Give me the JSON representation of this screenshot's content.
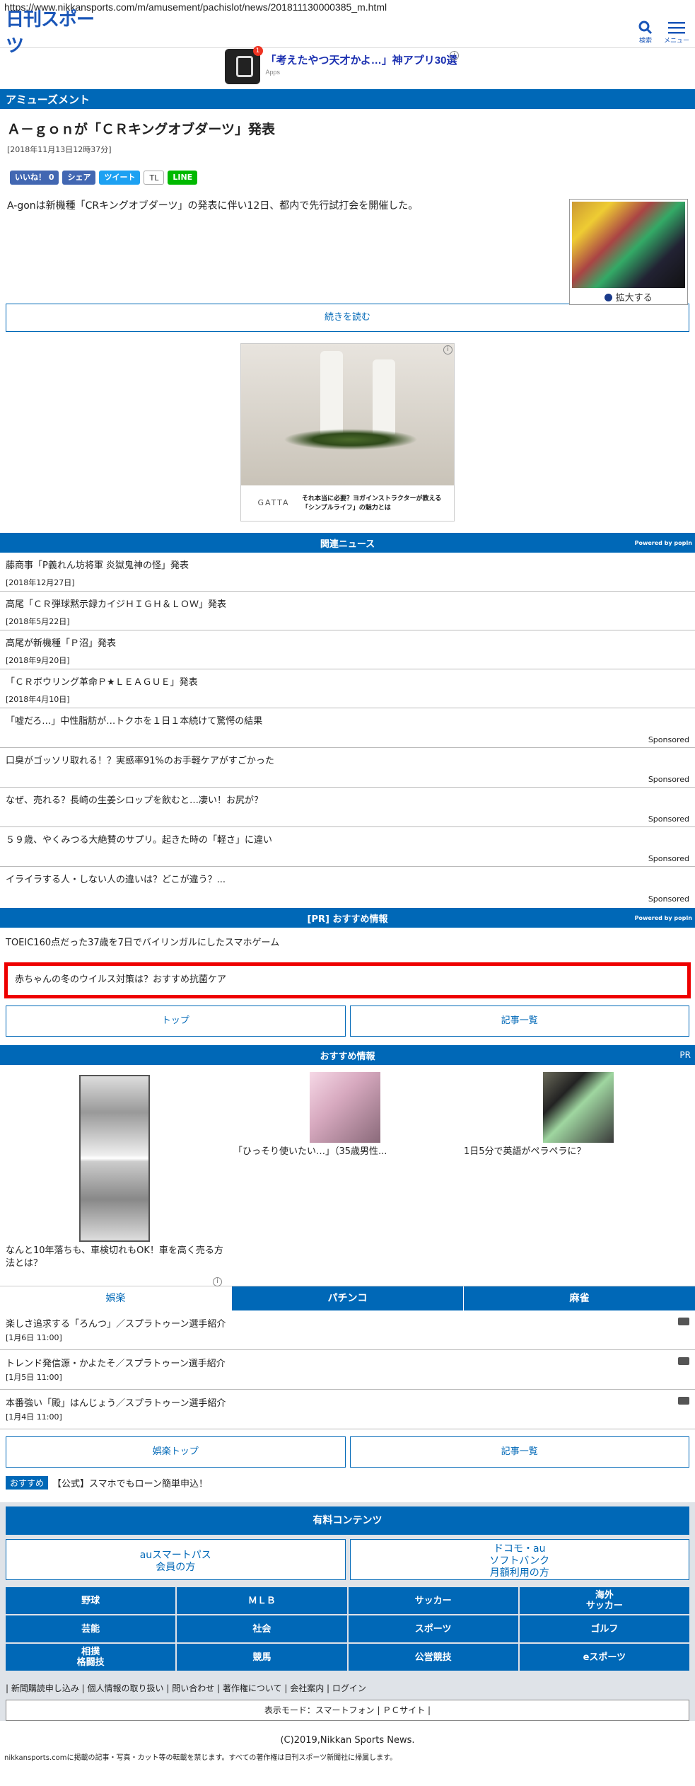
{
  "url": "https://www.nikkansports.com/m/amusement/pachislot/news/201811130000385_m.html",
  "header": {
    "logo": "日刊スポーツ",
    "search_label": "検索",
    "menu_label": "メニュー"
  },
  "ad_top": {
    "text": "「考えたやつ天才かよ…」神アプリ30選",
    "source": "Apps",
    "badge": "1"
  },
  "section": "アミューズメント",
  "article": {
    "title": "Ａ－ｇｏｎが「ＣＲキングオブダーツ」発表",
    "date": "[2018年11月13日12時37分]",
    "social": {
      "like": "いいね！ 0",
      "share": "シェア",
      "tweet": "ツイート",
      "tl": "TL",
      "line": "LINE"
    },
    "lead": "A-gonは新機種「CRキングオブダーツ」の発表に伴い12日、都内で先行試打会を開催した。",
    "photo_caption": "拡大する",
    "read_more": "続きを読む"
  },
  "ad_mid": {
    "brand": "GATTA",
    "text": "それ本当に必要？ヨガインストラクターが教える「シンプルライフ」の魅力とは"
  },
  "related": {
    "header": "関連ニュース",
    "powered": "Powered by popIn",
    "items": [
      {
        "title": "藤商事「P義れん坊将軍 炎獄鬼神の怪」発表",
        "date": "[2018年12月27日]"
      },
      {
        "title": "高尾「ＣＲ弾球黙示録カイジＨＩＧＨ＆ＬＯＷ」発表",
        "date": "[2018年5月22日]"
      },
      {
        "title": "高尾が新機種「Ｐ沼」発表",
        "date": "[2018年9月20日]"
      },
      {
        "title": "「ＣＲボウリング革命Ｐ★ＬＥＡＧＵＥ」発表",
        "date": "[2018年4月10日]"
      }
    ],
    "sponsored_label": "Sponsored",
    "sponsored": [
      "「嘘だろ…」中性脂肪が…トクホを１日１本続けて驚愕の結果",
      "口臭がゴッソリ取れる！？実感率91%のお手軽ケアがすごかった",
      "なぜ、売れる？長崎の生姜シロップを飲むと…凄い！お尻が？",
      "５９歳、やくみつる大絶賛のサプリ。起きた時の「軽さ」に違い",
      "イライラする人・しない人の違いは？どこが違う？..."
    ]
  },
  "pr": {
    "header": "[PR] おすすめ情報",
    "powered": "Powered by popIn",
    "item1": "TOEIC160点だった37歳を7日でバイリンガルにしたスマホゲーム",
    "item2": "赤ちゃんの冬のウイルス対策は？おすすめ抗菌ケア"
  },
  "nav1": {
    "top": "トップ",
    "list": "記事一覧"
  },
  "recommend": {
    "header": "おすすめ情報",
    "pr": "PR",
    "items": [
      "なんと10年落ちも、車検切れもOK！車を高く売る方法とは？",
      "「ひっそり使いたい…」（35歳男性...",
      "1日5分で英語がペラペラに？"
    ]
  },
  "tabs": [
    "娯楽",
    "パチンコ",
    "麻雀"
  ],
  "entertainment": [
    {
      "title": "楽しさ追求する「ろんつ」／スプラトゥーン選手紹介",
      "date": "[1月6日 11:00]"
    },
    {
      "title": "トレンド発信源・かよたそ／スプラトゥーン選手紹介",
      "date": "[1月5日 11:00]"
    },
    {
      "title": "本番強い「殿」はんじょう／スプラトゥーン選手紹介",
      "date": "[1月4日 11:00]"
    }
  ],
  "nav2": {
    "top": "娯楽トップ",
    "list": "記事一覧"
  },
  "osusume": {
    "tag": "おすすめ",
    "text": "【公式】スマホでもローン簡単申込！"
  },
  "footer": {
    "paid": "有料コンテンツ",
    "au": "auスマートパス\n会員の方",
    "docomo": "ドコモ・au\nソフトバンク\n月額利用の方",
    "grid": [
      "野球",
      "ＭＬＢ",
      "サッカー",
      "海外\nサッカー",
      "芸能",
      "社会",
      "スポーツ",
      "ゴルフ",
      "相撲\n格闘技",
      "競馬",
      "公営競技",
      "eスポーツ"
    ],
    "links": "| 新聞購読申し込み | 個人情報の取り扱い | 問い合わせ | 著作権について | 会社案内 | ログイン",
    "mode": "表示モード：スマートフォン | ＰＣサイト |",
    "copyright": "(C)2019,Nikkan Sports News.",
    "notice": "nikkansports.comに掲載の記事・写真・カット等の転載を禁じます。すべての著作権は日刊スポーツ新聞社に帰属します。"
  }
}
